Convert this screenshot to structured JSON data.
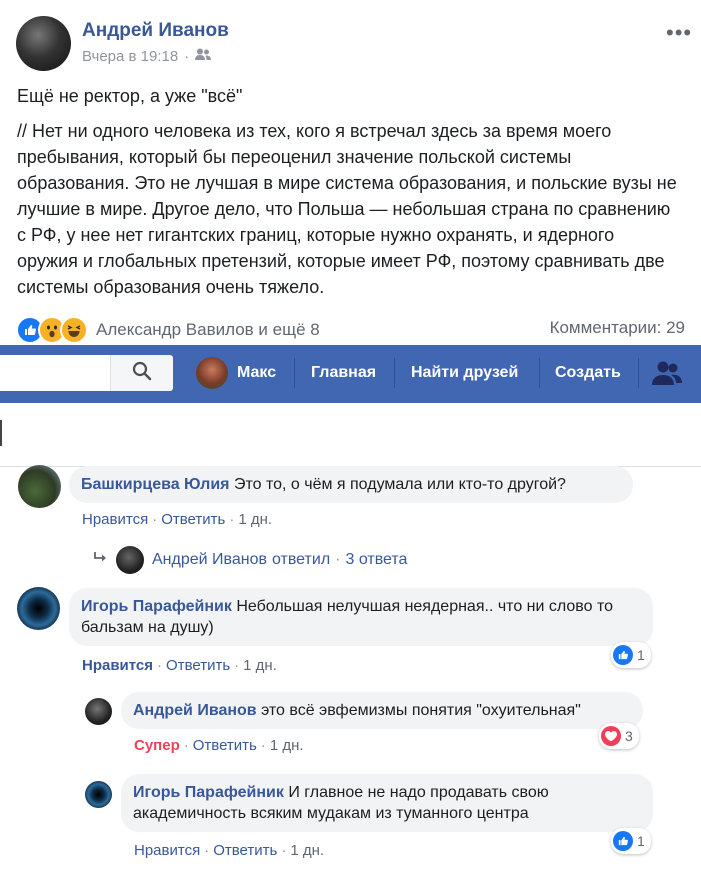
{
  "post": {
    "author": "Андрей Иванов",
    "time": "Вчера в 19:18",
    "audience_icon": "friends-icon",
    "title": "Ещё не ректор, а уже \"всё\"",
    "body": "// Нет ни одного человека из тех, кого я встречал здесь за время моего пребывания, который бы переоценил значение польской системы образования. Это не лучшая в мире система образования, и польские вузы не лучшие в мире. Другое дело, что Польша — небольшая страна по сравнению с РФ, у нее нет гигантских границ, которые нужно охранять, и ядерного оружия и глобальных претензий, которые имеет РФ, поэтому сравнивать две системы образования очень тяжело.",
    "reactions_text": "Александр Вавилов и ещё 8",
    "comments_count": "Комментарии: 29"
  },
  "navbar": {
    "user_name": "Макс",
    "home": "Главная",
    "find_friends": "Найти друзей",
    "create": "Создать",
    "color": "#4267b2"
  },
  "comments": [
    {
      "name": "Башкирцева Юлия",
      "text": "Это то, о чём я подумала или кто-то другой?",
      "like": "Нравится",
      "reply": "Ответить",
      "time": "1 дн.",
      "replies_summary": {
        "name": "Андрей Иванов",
        "replied": "ответил",
        "count": "3 ответа"
      }
    },
    {
      "name": "Игорь Парафейник",
      "text": "Небольшая нелучшая неядерная.. что ни слово то бальзам на душу)",
      "like": "Нравится",
      "reply": "Ответить",
      "time": "1 дн.",
      "reaction_count": "1"
    },
    {
      "name": "Андрей Иванов",
      "text": "это всё эвфемизмы понятия \"охуительная\"",
      "like": "Супер",
      "reply": "Ответить",
      "time": "1 дн.",
      "reaction_count": "3"
    },
    {
      "name": "Игорь Парафейник",
      "text": "И главное не надо продавать свою академичность всяким мудакам из туманного центра",
      "like": "Нравится",
      "reply": "Ответить",
      "time": "1 дн.",
      "reaction_count": "1"
    }
  ],
  "colors": {
    "link": "#385898",
    "love": "#f33e58",
    "like": "#1877f2"
  }
}
